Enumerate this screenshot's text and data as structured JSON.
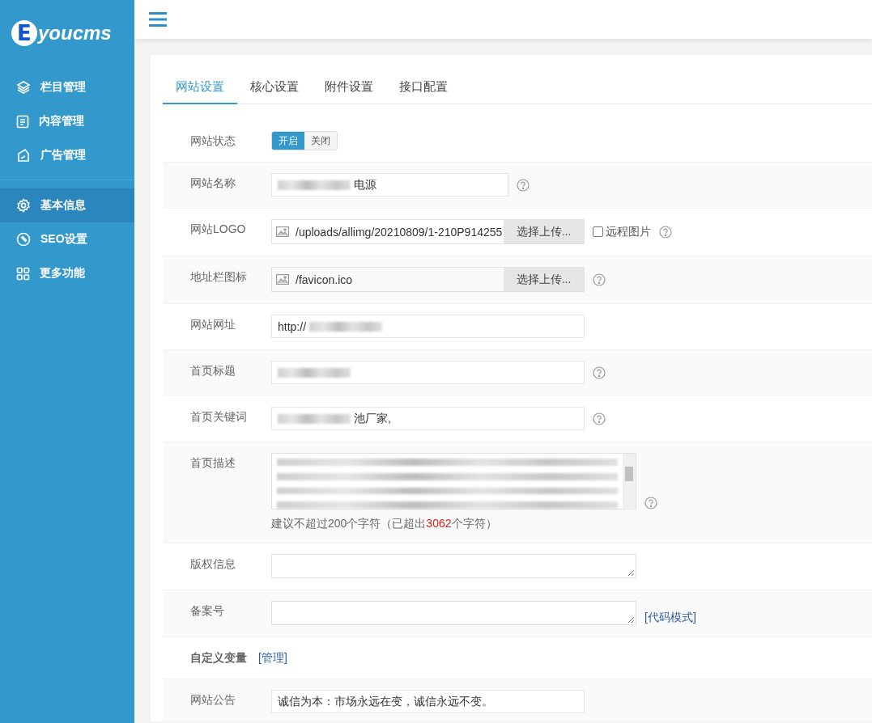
{
  "logo": {
    "letter": "E",
    "text": "youcms"
  },
  "sidebar": {
    "items": [
      {
        "label": "栏目管理",
        "selected": false
      },
      {
        "label": "内容管理",
        "selected": false
      },
      {
        "label": "广告管理",
        "selected": false
      },
      {
        "label": "基本信息",
        "selected": true
      },
      {
        "label": "SEO设置",
        "selected": false
      },
      {
        "label": "更多功能",
        "selected": false
      }
    ]
  },
  "tabs": [
    {
      "label": "网站设置",
      "selected": true
    },
    {
      "label": "核心设置",
      "selected": false
    },
    {
      "label": "附件设置",
      "selected": false
    },
    {
      "label": "接口配置",
      "selected": false
    }
  ],
  "form": {
    "rows": [
      {
        "kind": "toggle",
        "label": "网站状态",
        "options": [
          {
            "label": "开启",
            "selected": true
          },
          {
            "label": "关闭",
            "selected": false
          }
        ]
      },
      {
        "kind": "short_text",
        "label": "网站名称",
        "redacted": true,
        "value": "电源",
        "help": true
      },
      {
        "kind": "upload",
        "label": "网站LOGO",
        "value": "/uploads/allimg/20210809/1-210P914255",
        "button": "选择上传...",
        "remote": {
          "label": "远程图片",
          "checked": false
        },
        "help": true
      },
      {
        "kind": "upload",
        "label": "地址栏图标",
        "value": "/favicon.ico",
        "button": "选择上传...",
        "help": true
      },
      {
        "kind": "text",
        "label": "网站网址",
        "value": "http://",
        "redacted": true,
        "help": false
      },
      {
        "kind": "text",
        "label": "首页标题",
        "redacted": true,
        "help": true
      },
      {
        "kind": "text",
        "label": "首页关键词",
        "redacted": true,
        "value": "池厂家,",
        "help": true
      },
      {
        "kind": "description",
        "label": "首页描述",
        "redacted": true,
        "help": true,
        "note_before": "建议不超过200个字符（已超出",
        "note_count": "3062",
        "note_after": "个字符）"
      },
      {
        "kind": "textarea",
        "label": "版权信息",
        "help": false
      },
      {
        "kind": "textarea",
        "label": "备案号",
        "help": false,
        "link": "[代码模式]"
      },
      {
        "kind": "section",
        "label": "自定义变量",
        "link": "[管理]"
      },
      {
        "kind": "text",
        "label": "网站公告",
        "value": "诚信为本：市场永远在变，诚信永远不变。",
        "help": false
      }
    ]
  }
}
